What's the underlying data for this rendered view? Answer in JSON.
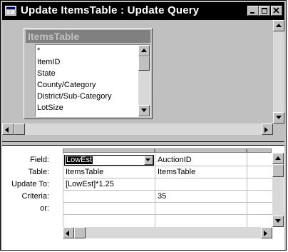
{
  "window": {
    "title": "Update ItemsTable : Update Query",
    "controls": [
      "minimize-icon",
      "restore-icon",
      "close-icon"
    ]
  },
  "table": {
    "name": "ItemsTable",
    "fields": [
      "*",
      "ItemID",
      "State",
      "County/Category",
      "District/Sub-Category",
      "LotSize"
    ]
  },
  "grid": {
    "row_labels": [
      "Field:",
      "Table:",
      "Update To:",
      "Criteria:",
      "or:"
    ],
    "columns": [
      {
        "field": "LowEst",
        "table": "ItemsTable",
        "update_to": "[LowEst]*1.25",
        "criteria": "",
        "or": ""
      },
      {
        "field": "AuctionID",
        "table": "ItemsTable",
        "update_to": "",
        "criteria": "35",
        "or": ""
      }
    ]
  },
  "colors": {
    "titlebar_bg": "#000000",
    "face": "#c0c0c0",
    "selection_bg": "#000000"
  }
}
